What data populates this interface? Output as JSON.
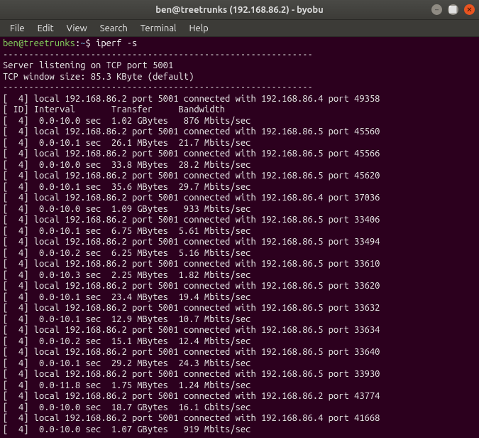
{
  "titlebar": {
    "title": "ben@treetrunks (192.168.86.2) - byobu"
  },
  "menubar": {
    "items": [
      "File",
      "Edit",
      "View",
      "Search",
      "Terminal",
      "Help"
    ]
  },
  "prompt": {
    "user": "ben",
    "at": "@",
    "host": "treetrunks",
    "colon": ":",
    "path": "~",
    "sep": "$ ",
    "command": "iperf -s"
  },
  "output_lines": [
    "------------------------------------------------------------",
    "Server listening on TCP port 5001",
    "TCP window size: 85.3 KByte (default)",
    "------------------------------------------------------------",
    "[  4] local 192.168.86.2 port 5001 connected with 192.168.86.4 port 49358",
    "[ ID] Interval       Transfer     Bandwidth",
    "[  4]  0.0-10.0 sec  1.02 GBytes   876 Mbits/sec",
    "[  4] local 192.168.86.2 port 5001 connected with 192.168.86.5 port 45560",
    "[  4]  0.0-10.1 sec  26.1 MBytes  21.7 Mbits/sec",
    "[  4] local 192.168.86.2 port 5001 connected with 192.168.86.5 port 45566",
    "[  4]  0.0-10.0 sec  33.8 MBytes  28.2 Mbits/sec",
    "[  4] local 192.168.86.2 port 5001 connected with 192.168.86.5 port 45620",
    "[  4]  0.0-10.1 sec  35.6 MBytes  29.7 Mbits/sec",
    "[  4] local 192.168.86.2 port 5001 connected with 192.168.86.4 port 37036",
    "[  4]  0.0-10.0 sec  1.09 GBytes   933 Mbits/sec",
    "[  4] local 192.168.86.2 port 5001 connected with 192.168.86.5 port 33406",
    "[  4]  0.0-10.1 sec  6.75 MBytes  5.61 Mbits/sec",
    "[  4] local 192.168.86.2 port 5001 connected with 192.168.86.5 port 33494",
    "[  4]  0.0-10.2 sec  6.25 MBytes  5.16 Mbits/sec",
    "[  4] local 192.168.86.2 port 5001 connected with 192.168.86.5 port 33610",
    "[  4]  0.0-10.3 sec  2.25 MBytes  1.82 Mbits/sec",
    "[  4] local 192.168.86.2 port 5001 connected with 192.168.86.5 port 33620",
    "[  4]  0.0-10.1 sec  23.4 MBytes  19.4 Mbits/sec",
    "[  4] local 192.168.86.2 port 5001 connected with 192.168.86.5 port 33632",
    "[  4]  0.0-10.1 sec  12.9 MBytes  10.7 Mbits/sec",
    "[  4] local 192.168.86.2 port 5001 connected with 192.168.86.5 port 33634",
    "[  4]  0.0-10.2 sec  15.1 MBytes  12.4 Mbits/sec",
    "[  4] local 192.168.86.2 port 5001 connected with 192.168.86.5 port 33640",
    "[  4]  0.0-10.1 sec  29.2 MBytes  24.3 Mbits/sec",
    "[  4] local 192.168.86.2 port 5001 connected with 192.168.86.5 port 33930",
    "[  4]  0.0-11.8 sec  1.75 MBytes  1.24 Mbits/sec",
    "[  4] local 192.168.86.2 port 5001 connected with 192.168.86.2 port 43774",
    "[  4]  0.0-10.0 sec  18.7 GBytes  16.1 Gbits/sec",
    "[  4] local 192.168.86.2 port 5001 connected with 192.168.86.4 port 41668",
    "[  4]  0.0-10.0 sec  1.07 GBytes   919 Mbits/sec"
  ]
}
